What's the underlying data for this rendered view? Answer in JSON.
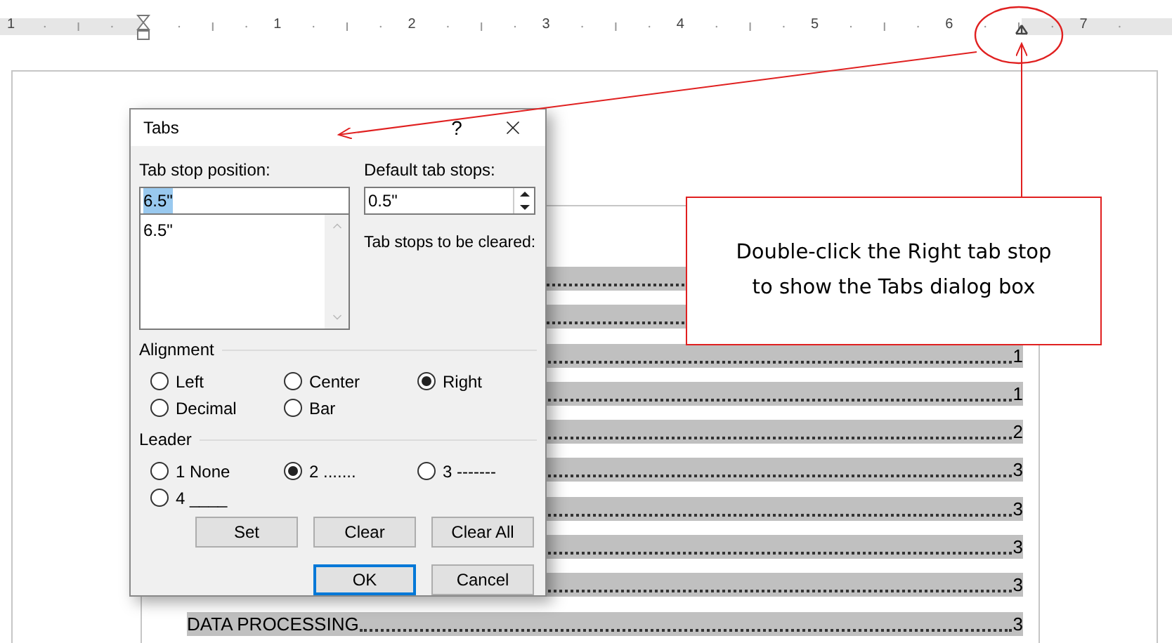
{
  "ruler": {
    "numbers": [
      "1",
      "1",
      "2",
      "3",
      "4",
      "5",
      "6",
      "7"
    ]
  },
  "document": {
    "toc_rows": [
      {},
      {},
      {
        "page": "1"
      },
      {
        "page": "1"
      },
      {
        "page": "2"
      },
      {
        "page": "3"
      },
      {
        "page": "3"
      },
      {
        "page": "3"
      },
      {
        "page": "3"
      },
      {
        "title": "DATA PROCESSING",
        "page": "3"
      }
    ]
  },
  "dialog": {
    "title": "Tabs",
    "help": "?",
    "tab_stop_position": {
      "label": "Tab stop position:",
      "value": "6.5\"",
      "highlighted": true
    },
    "tab_stop_list": [
      "6.5\""
    ],
    "default_tab_stops": {
      "label": "Default tab stops:",
      "value": "0.5\""
    },
    "clear_label": "Tab stops to be cleared:",
    "alignment": {
      "label": "Alignment",
      "options": [
        {
          "label": "Left",
          "selected": false
        },
        {
          "label": "Center",
          "selected": false
        },
        {
          "label": "Right",
          "selected": true
        },
        {
          "label": "Decimal",
          "selected": false
        },
        {
          "label": "Bar",
          "selected": false
        }
      ]
    },
    "leader": {
      "label": "Leader",
      "options": [
        {
          "label": "1 None",
          "selected": false
        },
        {
          "label": "2 .......",
          "selected": true
        },
        {
          "label": "3 -------",
          "selected": false
        },
        {
          "label": "4 ____",
          "selected": false
        }
      ]
    },
    "buttons": [
      {
        "label": "Set",
        "default": false
      },
      {
        "label": "Clear",
        "default": false
      },
      {
        "label": "Clear All",
        "default": false
      },
      {
        "label": "OK",
        "default": true
      },
      {
        "label": "Cancel",
        "default": false
      }
    ]
  },
  "callout": {
    "text": "Double-click the Right tab stop to show the Tabs dialog box"
  }
}
